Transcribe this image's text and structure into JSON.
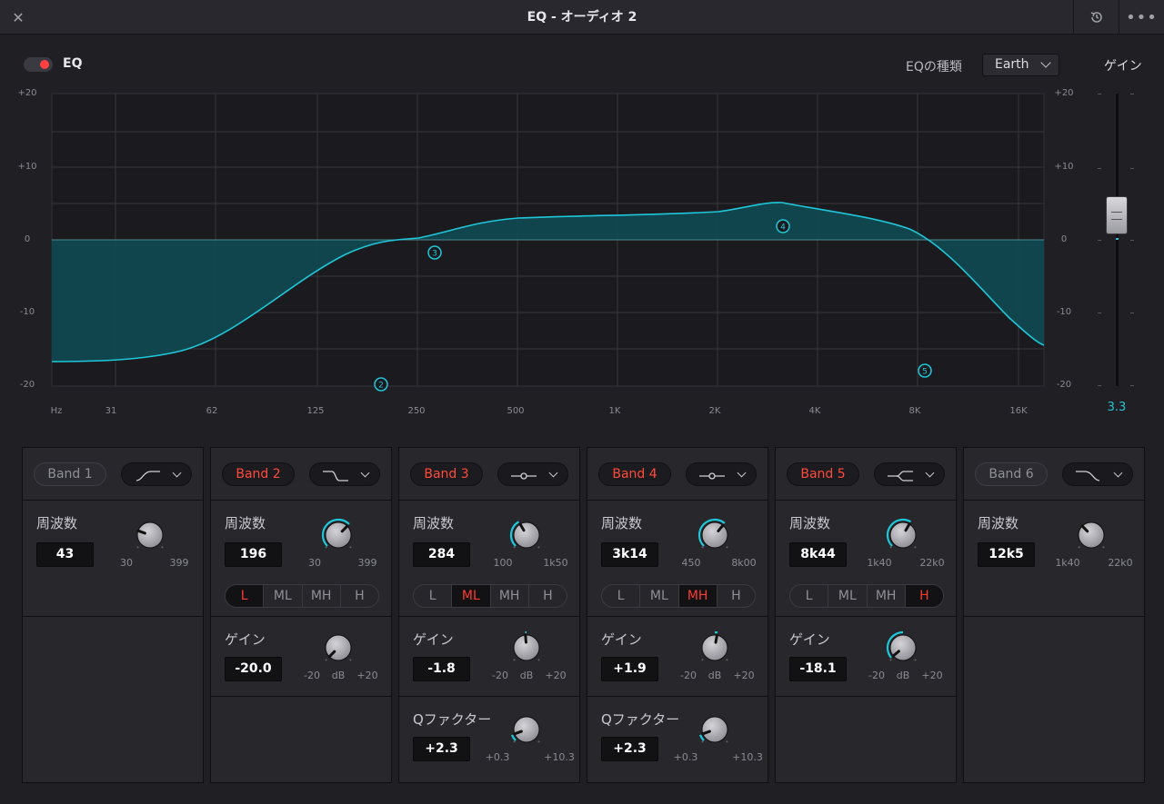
{
  "window": {
    "title": "EQ - オーディオ 2"
  },
  "header": {
    "eq_label": "EQ",
    "eq_type_label": "EQの種類",
    "eq_type_value": "Earth",
    "gain_label": "ゲイン",
    "gain_value": "3.3"
  },
  "graph": {
    "y_labels_left": [
      "+20",
      "+10",
      "0",
      "-10",
      "-20"
    ],
    "y_labels_right": [
      "+20",
      "+10",
      "0",
      "-10",
      "-20"
    ],
    "x_labels": [
      "Hz",
      "31",
      "62",
      "125",
      "250",
      "500",
      "1K",
      "2K",
      "4K",
      "8K",
      "16K"
    ],
    "nodes": [
      "2",
      "3",
      "4",
      "5"
    ],
    "colors": {
      "curve": "#1fc7d9",
      "fill": "#0f4a52"
    }
  },
  "bands": [
    {
      "label": "Band 1",
      "enabled": false,
      "shape": "high-pass-icon",
      "freq_label": "周波数",
      "freq_value": "43",
      "freq_min": "30",
      "freq_max": "399"
    },
    {
      "label": "Band 2",
      "enabled": true,
      "shape": "low-shelf-icon",
      "freq_label": "周波数",
      "freq_value": "196",
      "freq_min": "30",
      "freq_max": "399",
      "ranges": [
        "L",
        "ML",
        "MH",
        "H"
      ],
      "range_selected": "L",
      "gain_label": "ゲイン",
      "gain_value": "-20.0",
      "gain_min": "-20",
      "gain_unit": "dB",
      "gain_max": "+20"
    },
    {
      "label": "Band 3",
      "enabled": true,
      "shape": "bell-icon",
      "freq_label": "周波数",
      "freq_value": "284",
      "freq_min": "100",
      "freq_max": "1k50",
      "ranges": [
        "L",
        "ML",
        "MH",
        "H"
      ],
      "range_selected": "ML",
      "gain_label": "ゲイン",
      "gain_value": "-1.8",
      "gain_min": "-20",
      "gain_unit": "dB",
      "gain_max": "+20",
      "q_label": "Qファクター",
      "q_value": "+2.3",
      "q_min": "+0.3",
      "q_max": "+10.3"
    },
    {
      "label": "Band 4",
      "enabled": true,
      "shape": "bell-icon",
      "freq_label": "周波数",
      "freq_value": "3k14",
      "freq_min": "450",
      "freq_max": "8k00",
      "ranges": [
        "L",
        "ML",
        "MH",
        "H"
      ],
      "range_selected": "MH",
      "gain_label": "ゲイン",
      "gain_value": "+1.9",
      "gain_min": "-20",
      "gain_unit": "dB",
      "gain_max": "+20",
      "q_label": "Qファクター",
      "q_value": "+2.3",
      "q_min": "+0.3",
      "q_max": "+10.3"
    },
    {
      "label": "Band 5",
      "enabled": true,
      "shape": "high-shelf-icon",
      "freq_label": "周波数",
      "freq_value": "8k44",
      "freq_min": "1k40",
      "freq_max": "22k0",
      "ranges": [
        "L",
        "ML",
        "MH",
        "H"
      ],
      "range_selected": "H",
      "gain_label": "ゲイン",
      "gain_value": "-18.1",
      "gain_min": "-20",
      "gain_unit": "dB",
      "gain_max": "+20"
    },
    {
      "label": "Band 6",
      "enabled": false,
      "shape": "low-pass-icon",
      "freq_label": "周波数",
      "freq_value": "12k5",
      "freq_min": "1k40",
      "freq_max": "22k0"
    }
  ]
}
